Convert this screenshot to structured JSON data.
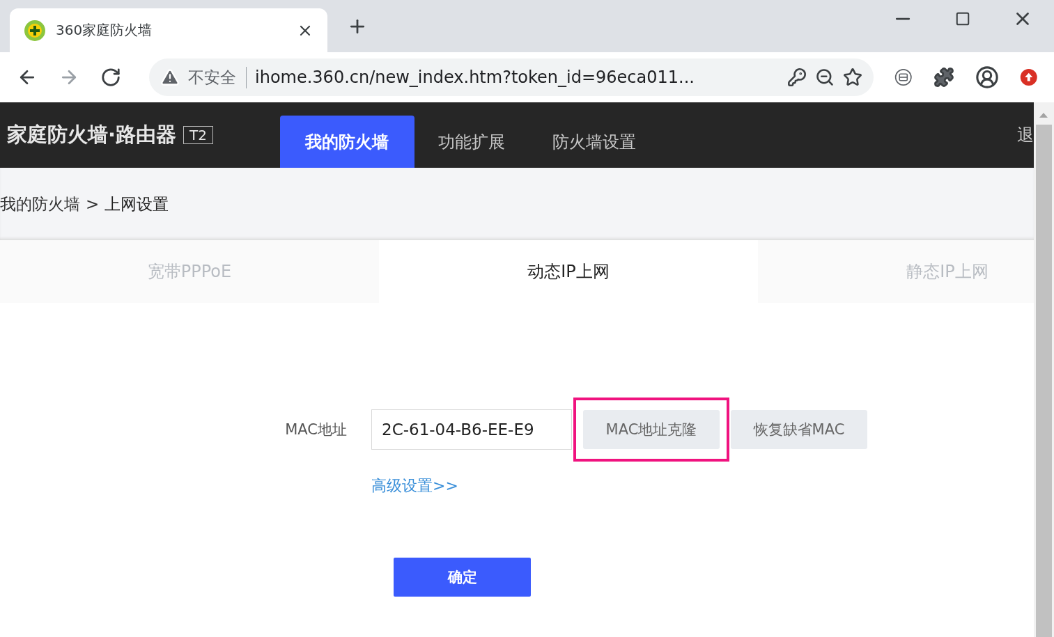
{
  "browser": {
    "tab": {
      "title": "360家庭防火墙",
      "selected": true
    },
    "address": {
      "security_label": "不安全",
      "url": "ihome.360.cn/new_index.htm?token_id=96eca011..."
    }
  },
  "header": {
    "brand": "家庭防火墙·路由器",
    "model_badge": "T2",
    "logout": "退",
    "nav": [
      {
        "label": "我的防火墙",
        "selected": true
      },
      {
        "label": "功能扩展",
        "selected": false
      },
      {
        "label": "防火墙设置",
        "selected": false
      }
    ]
  },
  "breadcrumb": {
    "parent": "我的防火墙",
    "separator": ">",
    "current": "上网设置"
  },
  "mode_tabs": [
    {
      "label": "宽带PPPoE",
      "selected": false
    },
    {
      "label": "动态IP上网",
      "selected": true
    },
    {
      "label": "静态IP上网",
      "selected": false
    }
  ],
  "form": {
    "mac_label": "MAC地址",
    "mac_value": "2C-61-04-B6-EE-E9",
    "buttons": [
      {
        "label": "MAC地址克隆",
        "highlighted": true
      },
      {
        "label": "恢复缺省MAC",
        "highlighted": false
      }
    ],
    "advanced_link": "高级设置>>",
    "submit": "确定"
  }
}
